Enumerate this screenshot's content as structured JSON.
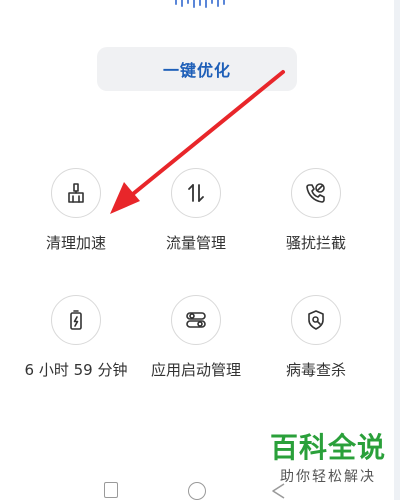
{
  "optimize_button": {
    "label": "一键优化"
  },
  "tiles": [
    {
      "label": "清理加速",
      "icon": "broom-icon"
    },
    {
      "label": "流量管理",
      "icon": "up-down-arrows-icon"
    },
    {
      "label": "骚扰拦截",
      "icon": "blocked-call-icon"
    },
    {
      "label": "6 小时 59 分钟",
      "icon": "battery-icon"
    },
    {
      "label": "应用启动管理",
      "icon": "toggle-switches-icon"
    },
    {
      "label": "病毒查杀",
      "icon": "shield-search-icon"
    }
  ],
  "watermark": {
    "main": "百科全说",
    "sub": "助你轻松解决"
  },
  "colors": {
    "accent_blue": "#1e5fb8",
    "arrow_red": "#e8262a",
    "watermark_green": "#2aa03a"
  }
}
